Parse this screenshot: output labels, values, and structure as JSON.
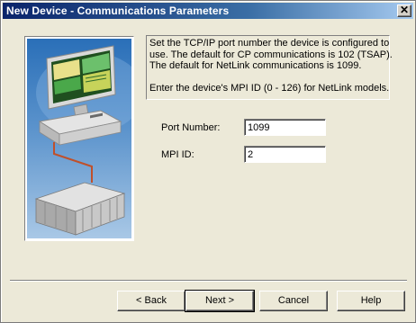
{
  "window": {
    "title": "New Device - Communications Parameters",
    "close_glyph": "✕"
  },
  "info": {
    "lines": [
      "Set the TCP/IP port number the device is configured to",
      "use.  The default for CP communications is 102 (TSAP).",
      "The default for NetLink communications is 1099."
    ],
    "mpi_note": "Enter the device's MPI ID (0 - 126) for NetLink models."
  },
  "fields": {
    "port_number": {
      "label": "Port Number:",
      "value": "1099"
    },
    "mpi_id": {
      "label": "MPI ID:",
      "value": "2"
    }
  },
  "buttons": {
    "back": "< Back",
    "next": "Next >",
    "cancel": "Cancel",
    "help": "Help"
  },
  "illustration": {
    "icons": [
      "computer-workstation-icon",
      "network-cable-icon",
      "plc-device-icon"
    ]
  }
}
